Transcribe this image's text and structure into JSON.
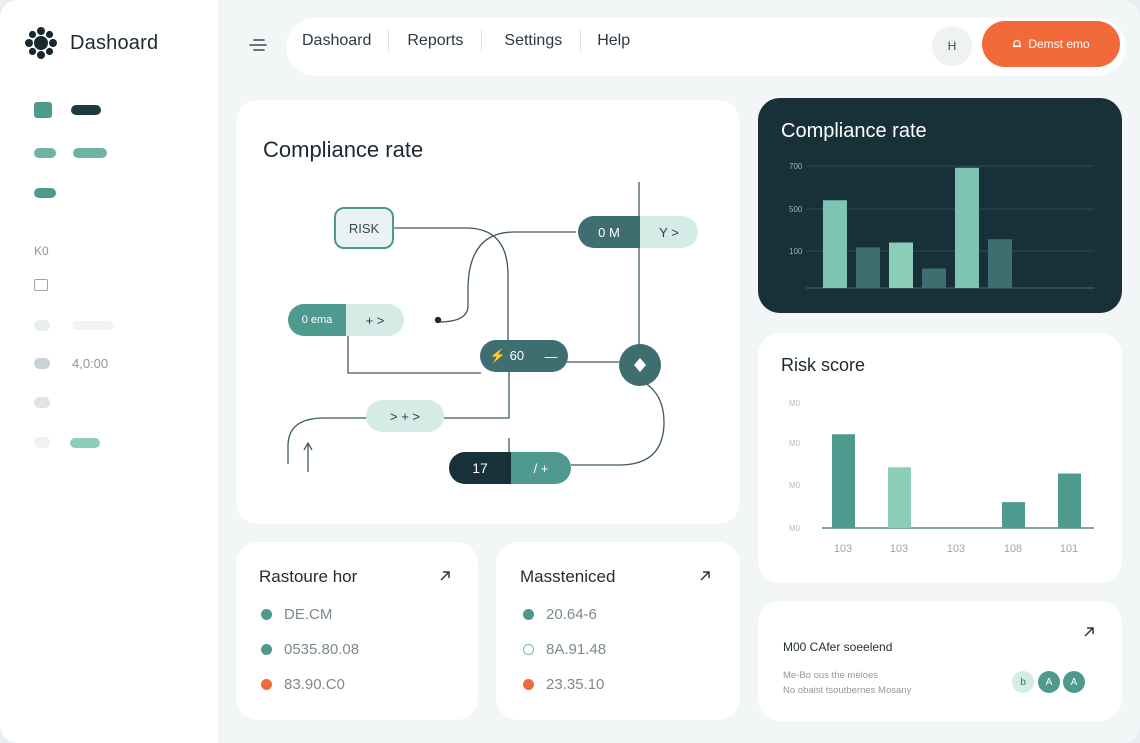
{
  "brand": {
    "name": "Dashoard"
  },
  "sidebar": {
    "label_a": "K0",
    "label_b": "4,0:00"
  },
  "nav": {
    "items": [
      "Dashoard",
      "Reports",
      "Settings",
      "Help"
    ],
    "round_button": "H",
    "cta_label": "Demst emo"
  },
  "flow_card": {
    "title": "Compliance rate",
    "nodes": {
      "risk": "RISK",
      "top_right_left": "0 M",
      "top_right_right": "Y >",
      "mid_left_left": "0 ema",
      "mid_left_right": "+ >",
      "center_left": "⚡ 60",
      "center_right": "—",
      "lower_mid": "> + >",
      "bottom_left": "17",
      "bottom_right": "/ +"
    }
  },
  "compliance_chart": {
    "title": "Compliance rate",
    "chart_data": {
      "type": "bar",
      "title": "Compliance rate",
      "y_ticks": [
        "700",
        "500",
        "100"
      ],
      "ylim": [
        0,
        800
      ],
      "values": [
        540,
        250,
        280,
        120,
        740,
        300
      ],
      "series_colors": [
        "#7fc4b2",
        "#3e6e70",
        "#8ccdb9",
        "#3e6e70",
        "#7fc4b2",
        "#3e6e70"
      ],
      "grid": true
    }
  },
  "risk_chart": {
    "title": "Risk score",
    "chart_data": {
      "type": "bar",
      "title": "Risk score",
      "categories": [
        "103",
        "103",
        "103",
        "108",
        "101"
      ],
      "y_ticks": [
        "M0",
        "M0",
        "M0",
        "M0"
      ],
      "values": [
        [
          105,
          0
        ],
        [
          68,
          0
        ],
        [
          0,
          0
        ],
        [
          29,
          0
        ],
        [
          61,
          0
        ]
      ],
      "ylim": [
        0,
        140
      ],
      "grid": false
    }
  },
  "bottom_card_1": {
    "title": "Rastoure hor",
    "rows": [
      {
        "value": "DE.CM",
        "color": "#4e9a8f"
      },
      {
        "value": "0535.80.08",
        "color": "#4e9a8f"
      },
      {
        "value": "83.90.C0",
        "color": "#f26a3a"
      }
    ]
  },
  "bottom_card_2": {
    "title": "Massteniced",
    "rows": [
      {
        "value": "20.64-6",
        "color": "#4e9a8f"
      },
      {
        "value": "8A.91.48",
        "color": "#ffffff"
      },
      {
        "value": "23.35.10",
        "color": "#f26a3a"
      }
    ]
  },
  "bottom_card_3": {
    "title": "M00 CAfer soeelend",
    "line1": "Me-Bo ous the meloes",
    "line2": "No obaist tsoutbernes Mosany",
    "avatar_1": "b",
    "avatar_2": "A",
    "avatar_3": "A"
  },
  "colors": {
    "accent": "#f26a3a",
    "teal_dark": "#3e6e70",
    "teal": "#4e9a8f",
    "teal_light": "#8ccdb9",
    "navy": "#183038"
  }
}
